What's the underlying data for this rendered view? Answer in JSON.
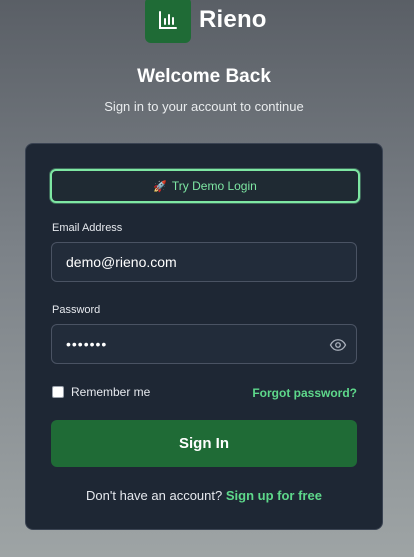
{
  "brand": {
    "name": "Rieno",
    "logo_icon": "bar-chart-icon",
    "logo_color": "#1f6b36"
  },
  "header": {
    "title": "Welcome Back",
    "subtitle": "Sign in to your account to continue"
  },
  "form": {
    "demo_button_label": "Try Demo Login",
    "demo_button_icon": "rocket-icon",
    "email_label": "Email Address",
    "email_value": "demo@rieno.com",
    "password_label": "Password",
    "password_masked": "•••••••",
    "password_toggle_icon": "eye-icon",
    "remember_label": "Remember me",
    "remember_checked": false,
    "forgot_label": "Forgot password?",
    "submit_label": "Sign In",
    "signup_prompt": "Don't have an account?",
    "signup_link": "Sign up for free"
  },
  "colors": {
    "accent": "#5ed88b",
    "primary_button": "#1f6b36",
    "card_bg": "#1e2734"
  }
}
